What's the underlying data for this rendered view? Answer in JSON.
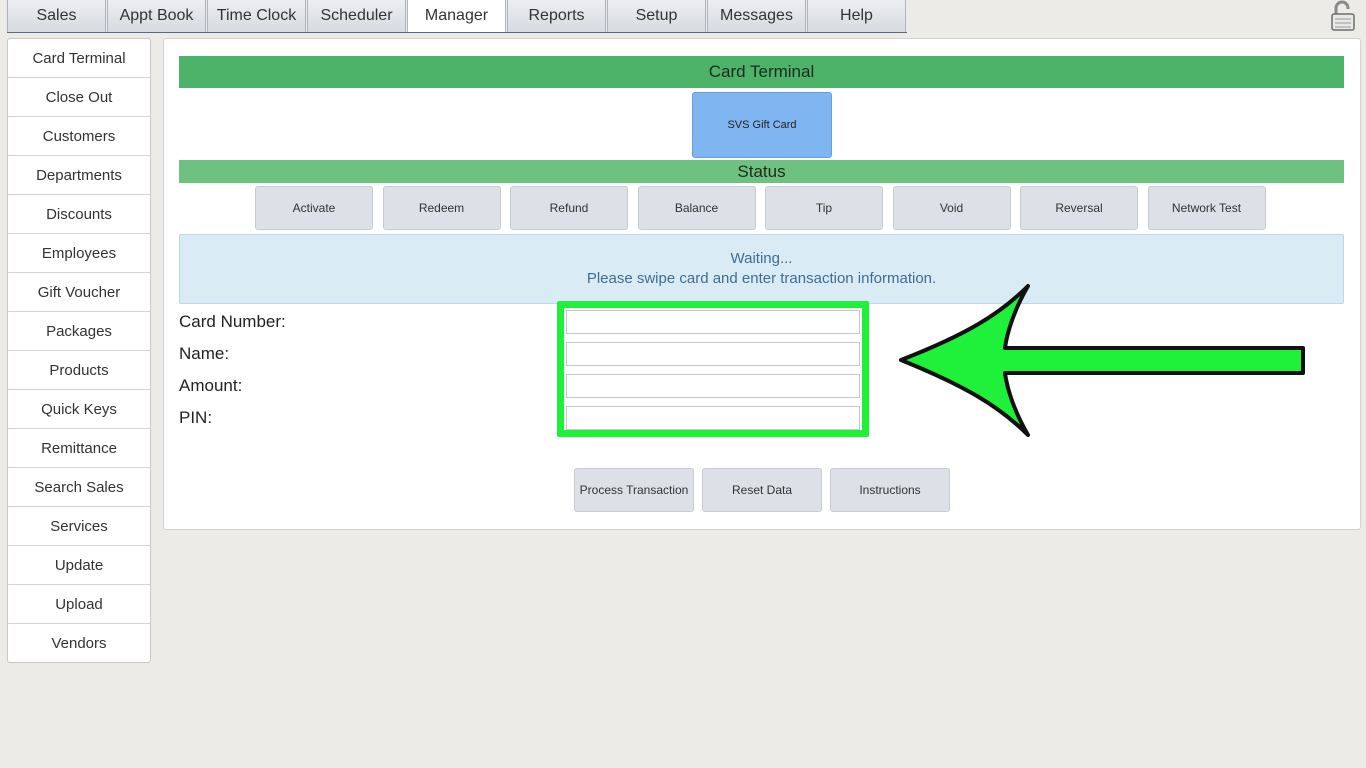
{
  "tabs": [
    "Sales",
    "Appt Book",
    "Time Clock",
    "Scheduler",
    "Manager",
    "Reports",
    "Setup",
    "Messages",
    "Help"
  ],
  "active_tab": "Manager",
  "sidebar": [
    "Card Terminal",
    "Close Out",
    "Customers",
    "Departments",
    "Discounts",
    "Employees",
    "Gift Voucher",
    "Packages",
    "Products",
    "Quick Keys",
    "Remittance",
    "Search Sales",
    "Services",
    "Update",
    "Upload",
    "Vendors"
  ],
  "panel": {
    "title": "Card Terminal",
    "gift_button": "SVS Gift Card",
    "status_title": "Status",
    "actions": [
      "Activate",
      "Redeem",
      "Refund",
      "Balance",
      "Tip",
      "Void",
      "Reversal",
      "Network Test"
    ],
    "waiting_line1": "Waiting...",
    "waiting_line2": "Please swipe card and enter transaction information.",
    "fields": {
      "card_number": {
        "label": "Card Number:",
        "value": ""
      },
      "name": {
        "label": "Name:",
        "value": ""
      },
      "amount": {
        "label": "Amount:",
        "value": ""
      },
      "pin": {
        "label": "PIN:",
        "value": ""
      }
    },
    "bottom_buttons": [
      "Process Transaction",
      "Reset Data",
      "Instructions"
    ]
  },
  "colors": {
    "header_green": "#4cb368",
    "status_green": "#6fc17f",
    "gift_blue": "#7fb5f0",
    "highlight_green": "#1ff03a"
  },
  "icons": {
    "lock": "padlock-icon",
    "arrow": "arrow-left-icon"
  }
}
